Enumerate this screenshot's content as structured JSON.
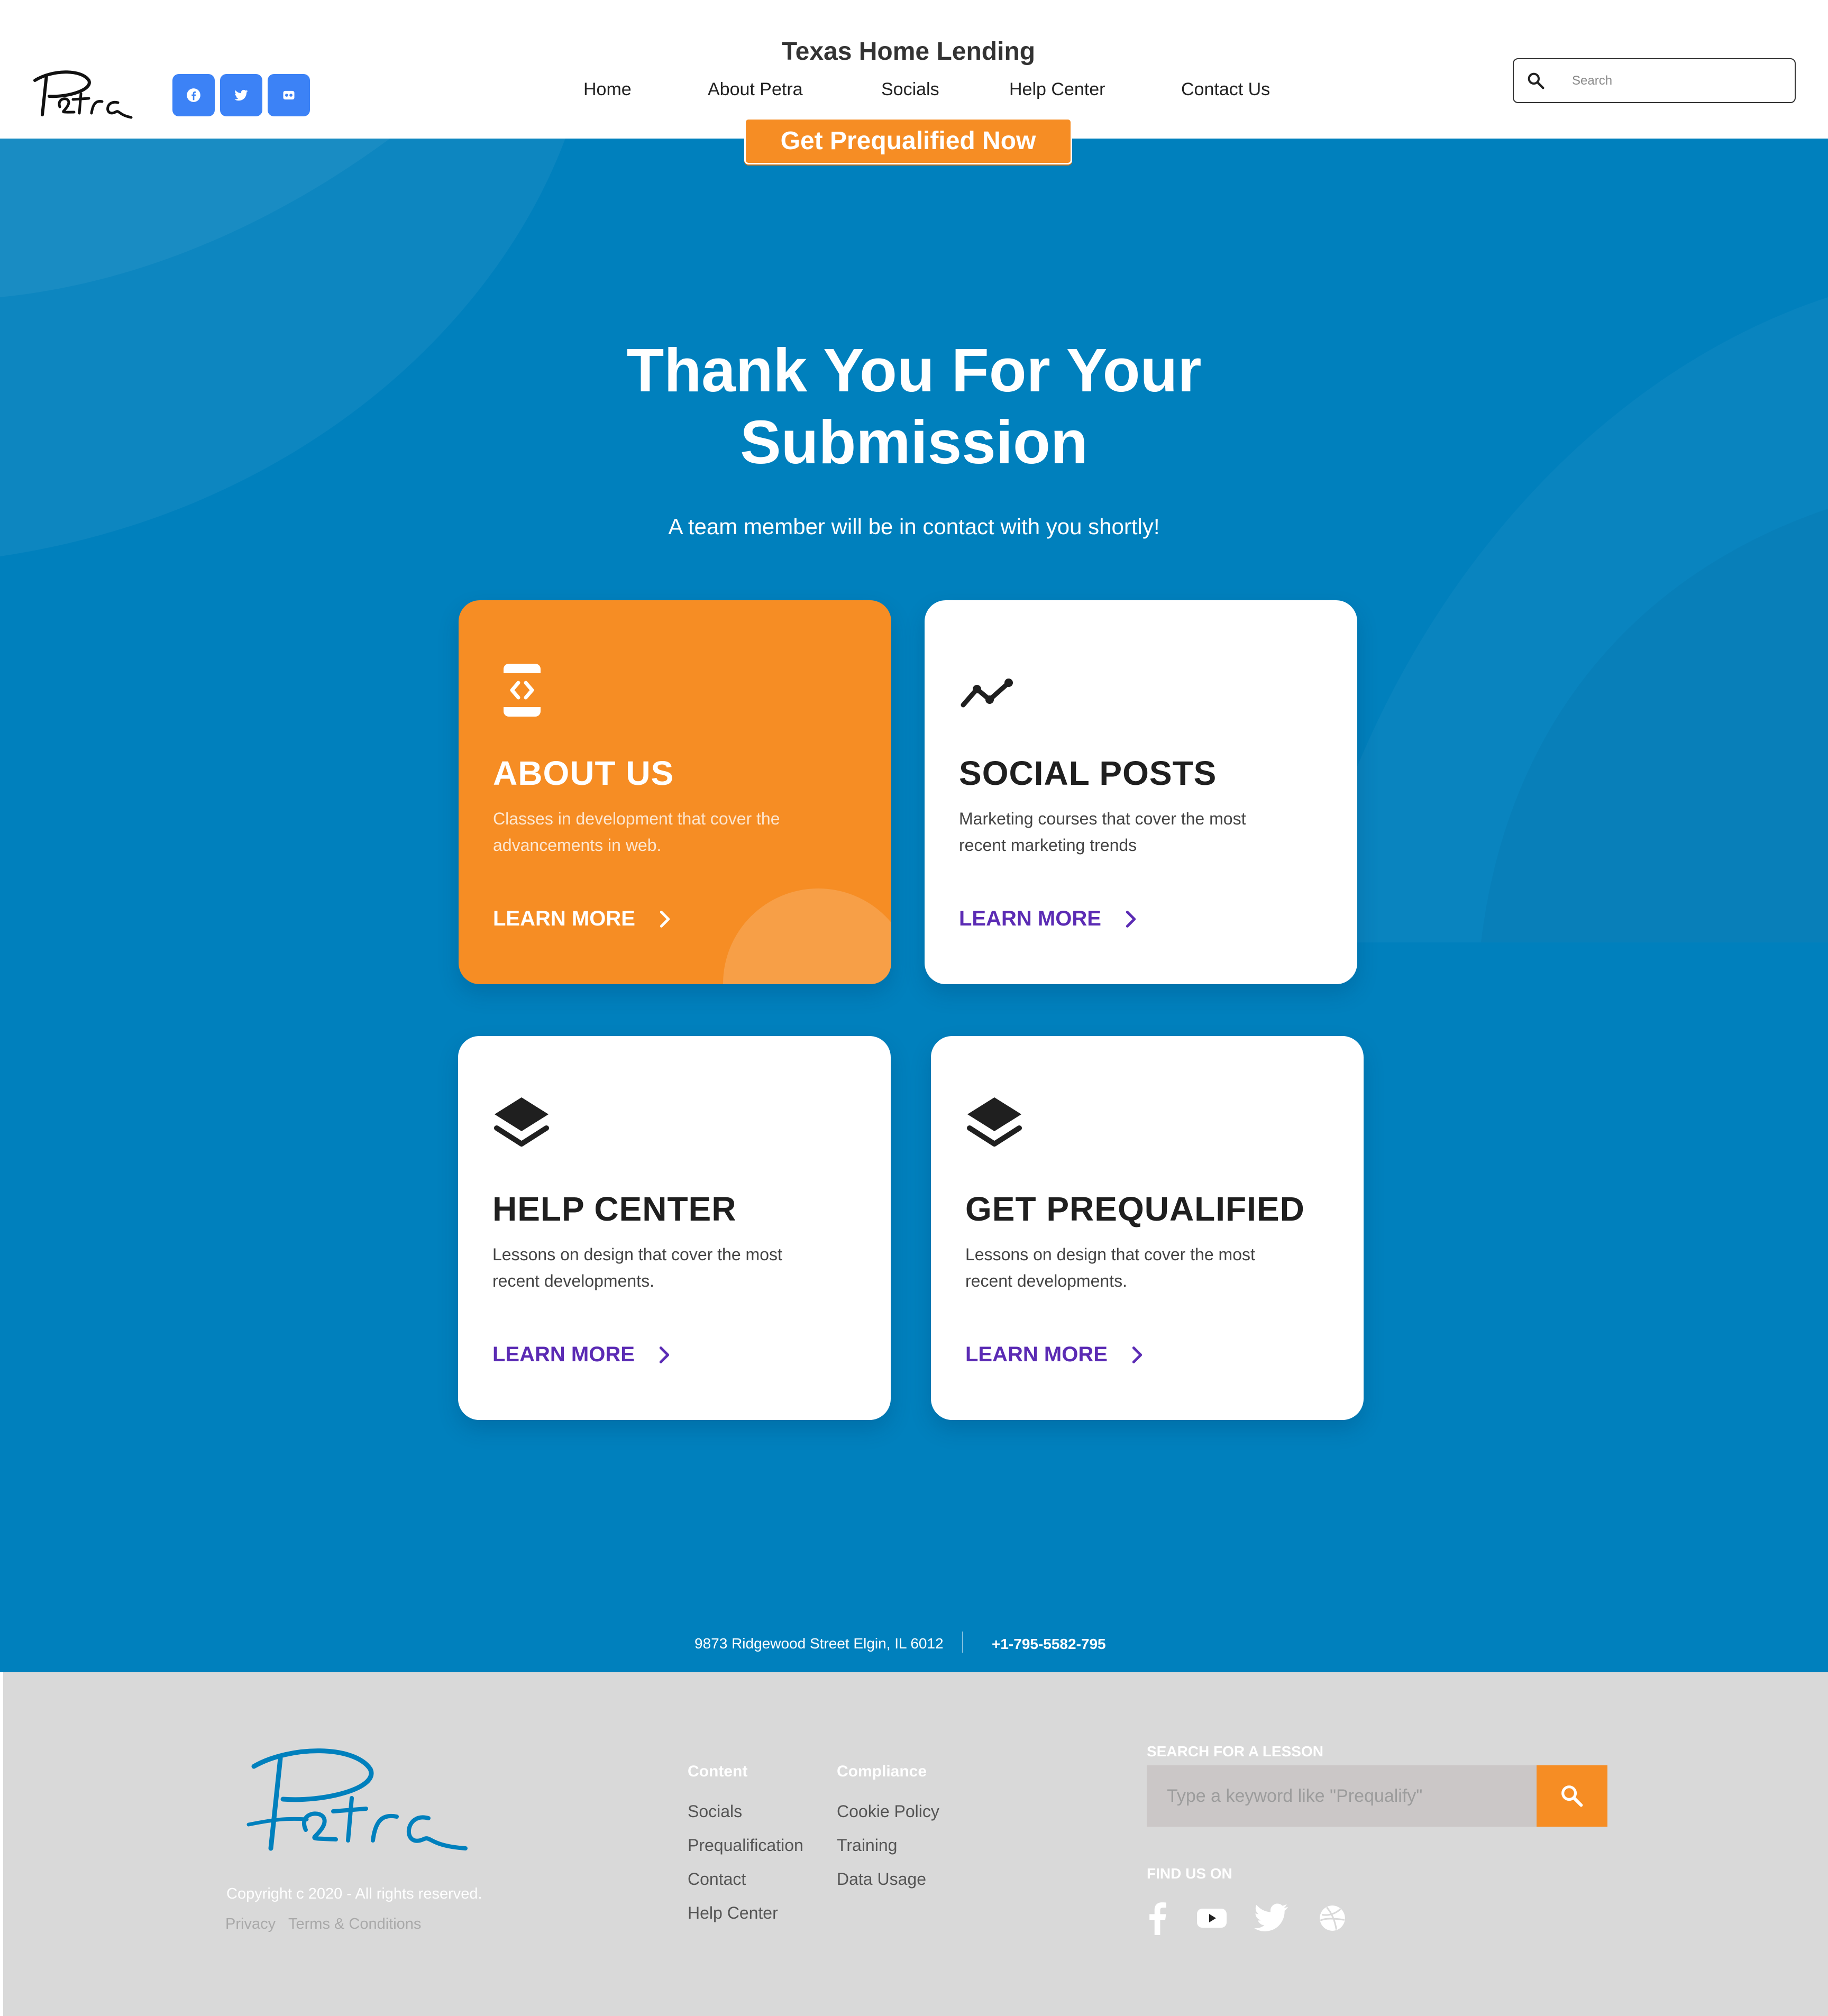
{
  "header": {
    "logo_text": "Petra",
    "site_title": "Texas Home Lending",
    "social_icons": [
      "facebook-icon",
      "twitter-icon",
      "flickr-icon"
    ],
    "nav": [
      "Home",
      "About Petra",
      "Socials",
      "Help Center",
      "Contact Us"
    ],
    "search_placeholder": "Search",
    "cta_label": "Get Prequalified Now"
  },
  "hero": {
    "title_line1": "Thank You For Your",
    "title_line2": "Submission",
    "subtitle": "A team member will be in contact with you shortly!",
    "cards": [
      {
        "title": "ABOUT US",
        "description": "Classes in development that cover the advancements in web.",
        "link": "LEARN MORE",
        "icon": "phone-code-icon"
      },
      {
        "title": "SOCIAL POSTS",
        "description": "Marketing courses that cover the most recent marketing trends",
        "link": "LEARN MORE",
        "icon": "trend-line-icon"
      },
      {
        "title": "HELP CENTER",
        "description": "Lessons on design that cover the most recent developments.",
        "link": "LEARN MORE",
        "icon": "layers-icon"
      },
      {
        "title": "GET PREQUALIFIED",
        "description": "Lessons on design that cover the most recent developments.",
        "link": "LEARN MORE",
        "icon": "layers-icon"
      }
    ],
    "address": "9873 Ridgewood Street Elgin, IL 6012",
    "phone": "+1-795-5582-795"
  },
  "footer": {
    "logo_text": "Petra",
    "copyright": "Copyright c 2020 - All rights reserved.",
    "privacy": "Privacy",
    "terms": "Terms & Conditions",
    "columns": [
      {
        "heading": "Content",
        "links": [
          "Socials",
          "Prequalification",
          "Contact",
          "Help Center"
        ]
      },
      {
        "heading": "Compliance",
        "links": [
          "Cookie Policy",
          "Training",
          "Data Usage"
        ]
      }
    ],
    "lesson_search": {
      "heading": "SEARCH FOR A LESSON",
      "placeholder": "Type a keyword like \"Prequalify\""
    },
    "find_us": {
      "heading": "FIND US ON",
      "icons": [
        "facebook-icon",
        "youtube-icon",
        "twitter-icon",
        "dribbble-icon"
      ]
    }
  },
  "colors": {
    "hero_blue": "#0080bd",
    "accent_orange": "#f68d24",
    "link_purple": "#5b2bb4",
    "social_blue": "#3c82f6",
    "footer_gray": "#d9d9d9"
  }
}
